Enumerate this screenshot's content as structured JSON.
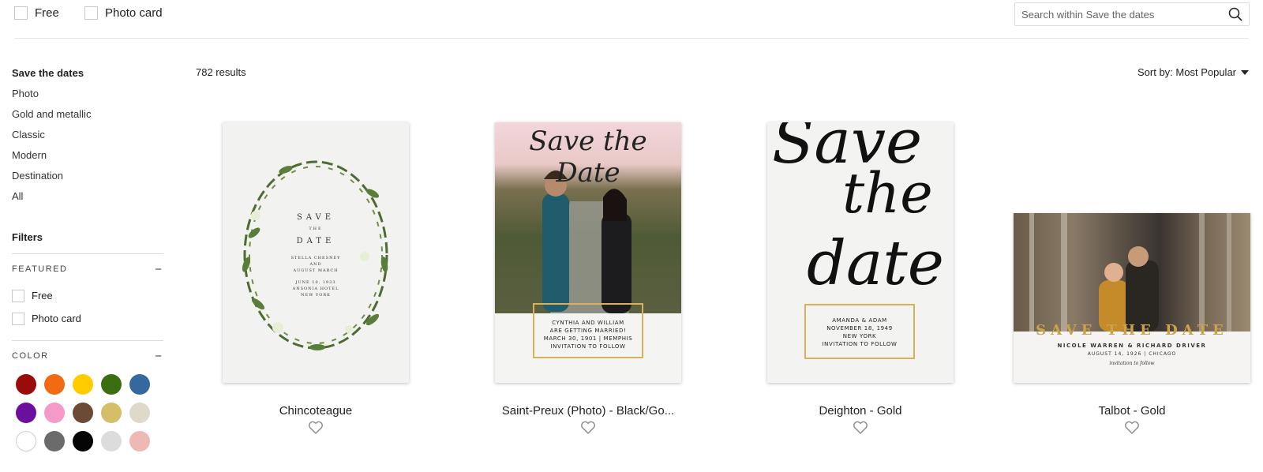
{
  "topbar": {
    "filters": [
      {
        "label": "Free",
        "checked": false
      },
      {
        "label": "Photo card",
        "checked": false
      }
    ],
    "search": {
      "placeholder": "Search within Save the dates",
      "value": ""
    }
  },
  "sidebar": {
    "category_title": "Save the dates",
    "categories": [
      "Photo",
      "Gold and metallic",
      "Classic",
      "Modern",
      "Destination",
      "All"
    ],
    "filters_title": "Filters",
    "featured": {
      "title": "FEATURED",
      "collapse_symbol": "−",
      "options": [
        {
          "label": "Free",
          "checked": false
        },
        {
          "label": "Photo card",
          "checked": false
        }
      ]
    },
    "color": {
      "title": "COLOR",
      "collapse_symbol": "−",
      "swatches": [
        "#9a0c0c",
        "#f26a12",
        "#ffcc00",
        "#3b6e10",
        "#35689f",
        "#6a0f9e",
        "#f59ac8",
        "#6b4a36",
        "#d4bf68",
        "#dfd9c9",
        "#ffffff",
        "#6b6b6b",
        "#050505",
        "#dcdcdc",
        "#eeb9b5"
      ]
    }
  },
  "results": {
    "count_label": "782 results",
    "sort_label": "Sort by: Most Popular"
  },
  "products": [
    {
      "name": "Chincoteague",
      "favorite": false,
      "card_text": {
        "save": "SAVE",
        "the": "THE",
        "date": "DATE",
        "names_1": "STELLA CHESNEY",
        "names_and": "AND",
        "names_2": "AUGUST MARCH",
        "date_line": "JUNE 10, 1933",
        "venue": "ANSONIA HOTEL",
        "city": "NEW YORK"
      }
    },
    {
      "name": "Saint-Preux (Photo) - Black/Go...",
      "favorite": false,
      "card_text": {
        "script": "Save the Date",
        "line1": "CYNTHIA AND WILLIAM",
        "line2": "ARE GETTING MARRIED!",
        "line3": "MARCH 30, 1901 | MEMPHIS",
        "line4": "INVITATION TO FOLLOW"
      }
    },
    {
      "name": "Deighton - Gold",
      "favorite": false,
      "card_text": {
        "script_1": "Save",
        "script_2": "the",
        "script_3": "date",
        "line1": "AMANDA & ADAM",
        "line2": "NOVEMBER 18, 1949",
        "line3": "NEW YORK",
        "line4": "INVITATION TO FOLLOW"
      }
    },
    {
      "name": "Talbot - Gold",
      "favorite": false,
      "card_text": {
        "headline": "SAVE THE DATE",
        "names": "NICOLE WARREN & RICHARD DRIVER",
        "date_line": "AUGUST 14, 1926 | CHICAGO",
        "follow": "invitation to follow"
      }
    }
  ]
}
